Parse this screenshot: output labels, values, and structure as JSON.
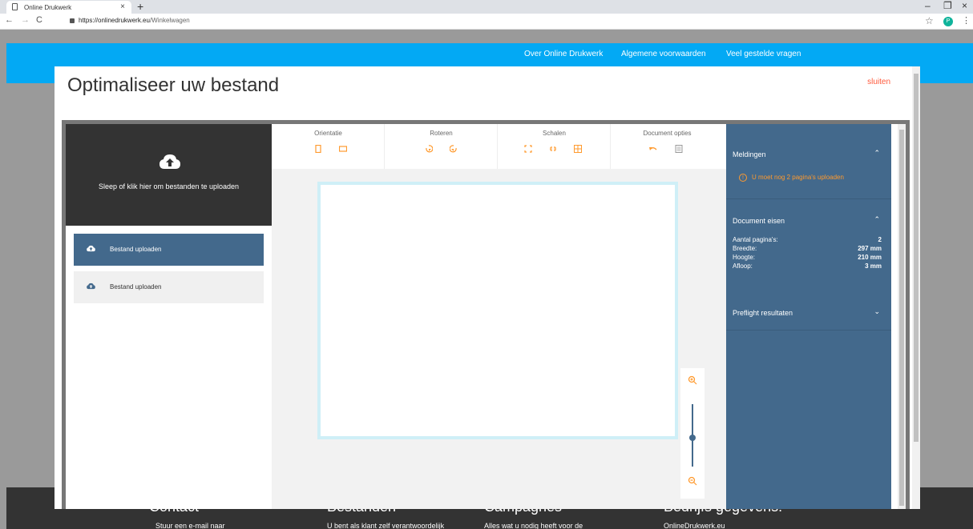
{
  "browser": {
    "tab_title": "Online Drukwerk",
    "tab_close": "×",
    "new_tab": "+",
    "url_host": "https://onlinedrukwerk.eu",
    "url_path": "/Winkelwagen",
    "avatar_letter": "P",
    "window_controls": [
      "–",
      "❐",
      "×"
    ]
  },
  "site": {
    "topnav": [
      "Over Online Drukwerk",
      "Algemene voorwaarden",
      "Veel gestelde vragen"
    ],
    "footer": {
      "headings": [
        "Contact",
        "Bestanden",
        "Campagnes",
        "Bedrijfs gegevens:"
      ],
      "texts": [
        "Stuur een e-mail naar",
        "U bent als klant zelf verantwoordelijk",
        "Alles wat u nodig heeft voor de",
        "OnlineDrukwerk.eu"
      ]
    }
  },
  "modal": {
    "title": "Optimaliseer uw bestand",
    "close_label": "sluiten",
    "dropzone_text": "Sleep of klik hier om bestanden te uploaden",
    "files": [
      {
        "label": "Bestand uploaden",
        "active": true
      },
      {
        "label": "Bestand uploaden",
        "active": false
      }
    ],
    "toolbar": {
      "groups": [
        {
          "label": "Orientatie",
          "icons": [
            "portrait-icon",
            "landscape-icon"
          ]
        },
        {
          "label": "Roteren",
          "icons": [
            "rotate-left-icon",
            "rotate-right-icon"
          ]
        },
        {
          "label": "Schalen",
          "icons": [
            "fit-icon",
            "shrink-icon",
            "grid-icon"
          ]
        },
        {
          "label": "Document opties",
          "icons": [
            "undo-icon",
            "document-icon"
          ]
        }
      ]
    },
    "panel": {
      "meldingen": {
        "title": "Meldingen",
        "warning": "U moet nog 2 pagina's uploaden"
      },
      "document_eisen": {
        "title": "Document eisen",
        "rows": [
          {
            "label": "Aantal pagina's:",
            "value": "2"
          },
          {
            "label": "Breedte:",
            "value": "297 mm"
          },
          {
            "label": "Hoogte:",
            "value": "210 mm"
          },
          {
            "label": "Afloop:",
            "value": "3 mm"
          }
        ]
      },
      "preflight": {
        "title": "Preflight resultaten"
      }
    }
  },
  "colors": {
    "accent": "#ff9a2e",
    "panel": "#43698c",
    "header": "#03a9f4",
    "close": "#ff5a3c"
  }
}
